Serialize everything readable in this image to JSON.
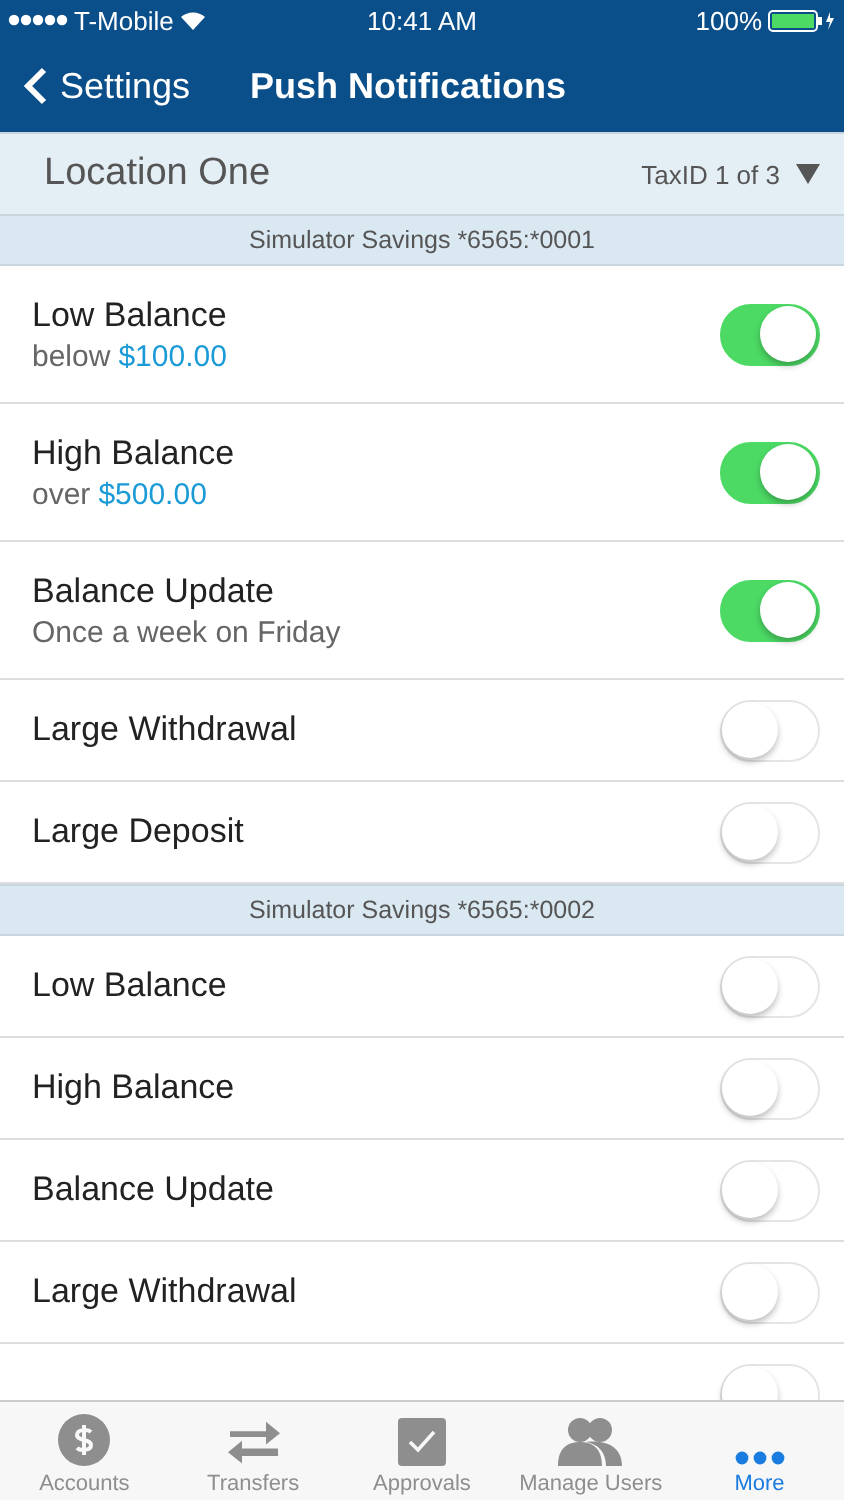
{
  "status_bar": {
    "carrier": "T-Mobile",
    "time": "10:41 AM",
    "battery": "100%"
  },
  "nav": {
    "back": "Settings",
    "title": "Push Notifications"
  },
  "location": {
    "name": "Location One",
    "taxid": "TaxID 1 of 3"
  },
  "sections": [
    {
      "title": "Simulator Savings *6565:*0001",
      "rows": [
        {
          "label": "Low Balance",
          "detail": "below",
          "amount": "$100.00",
          "on": true
        },
        {
          "label": "High Balance",
          "detail": "over",
          "amount": "$500.00",
          "on": true
        },
        {
          "label": "Balance Update",
          "detail": "Once a week on Friday",
          "on": true
        },
        {
          "label": "Large Withdrawal",
          "on": false
        },
        {
          "label": "Large Deposit",
          "on": false
        }
      ]
    },
    {
      "title": "Simulator Savings *6565:*0002",
      "rows": [
        {
          "label": "Low Balance",
          "on": false
        },
        {
          "label": "High Balance",
          "on": false
        },
        {
          "label": "Balance Update",
          "on": false
        },
        {
          "label": "Large Withdrawal",
          "on": false
        },
        {
          "on": false
        }
      ]
    }
  ],
  "tabs": [
    {
      "label": "Accounts",
      "kind": "dollar",
      "selected": false
    },
    {
      "label": "Transfers",
      "kind": "arrows",
      "selected": false
    },
    {
      "label": "Approvals",
      "kind": "check",
      "selected": false
    },
    {
      "label": "Manage Users",
      "kind": "users",
      "selected": false
    },
    {
      "label": "More",
      "kind": "more",
      "selected": true
    }
  ]
}
